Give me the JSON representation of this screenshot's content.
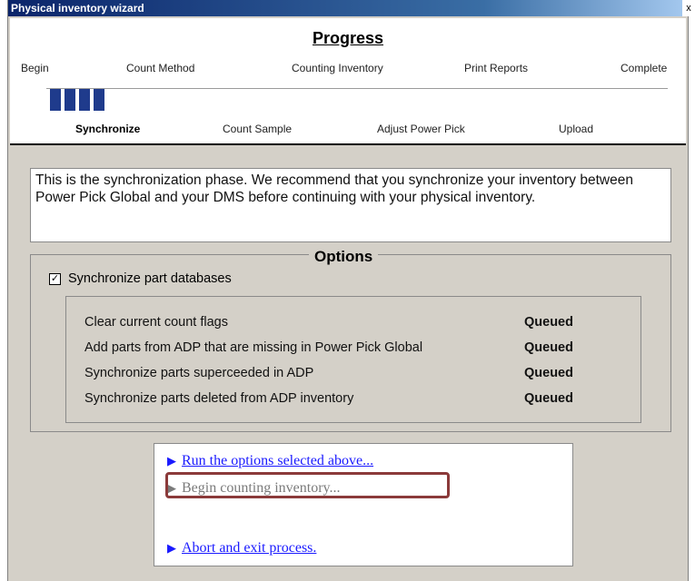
{
  "window": {
    "title": "Physical inventory wizard",
    "close_glyph": "x"
  },
  "progress": {
    "title": "Progress",
    "steps": [
      "Begin",
      "Count Method",
      "Counting Inventory",
      "Print Reports",
      "Complete"
    ],
    "bars_filled": 4,
    "subphases": [
      "Synchronize",
      "Count Sample",
      "Adjust Power Pick",
      "Upload"
    ],
    "active_subphase": "Synchronize"
  },
  "description": "This is the synchronization phase.  We recommend that you synchronize your inventory between Power Pick Global and your DMS before continuing with your physical inventory.",
  "options": {
    "title": "Options",
    "checkbox_label": "Synchronize part databases",
    "checkbox_checked": true,
    "tasks": [
      {
        "label": "Clear current count flags",
        "status": "Queued"
      },
      {
        "label": "Add parts from ADP that are missing in Power Pick Global",
        "status": "Queued"
      },
      {
        "label": "Synchronize parts superceeded in ADP",
        "status": "Queued"
      },
      {
        "label": "Synchronize parts deleted from ADP inventory",
        "status": "Queued"
      }
    ]
  },
  "actions": {
    "run": "Run the options selected above...",
    "begin": "Begin counting inventory...",
    "abort": "Abort and exit process."
  },
  "colors": {
    "link": "#1a1aff",
    "progress_bar": "#1f3b8c",
    "highlight": "#8b3a3a",
    "disabled": "#7a7a7a"
  },
  "icons": {
    "action_arrow": "triangle-right-icon",
    "checkmark": "checkmark-icon"
  }
}
